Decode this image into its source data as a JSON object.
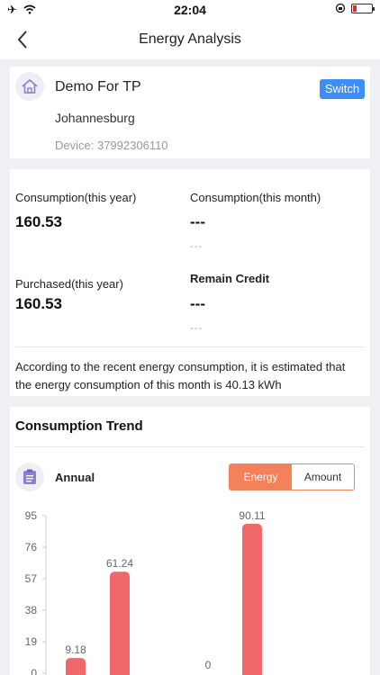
{
  "status_bar": {
    "time": "22:04"
  },
  "nav": {
    "title": "Energy Analysis"
  },
  "device": {
    "name": "Demo For TP",
    "city": "Johannesburg",
    "device_id": "Device: 37992306110",
    "switch_label": "Switch"
  },
  "stats": {
    "consumption_year_label": "Consumption(this year)",
    "consumption_year_value": "160.53",
    "consumption_month_label": "Consumption(this month)",
    "consumption_month_value": "---",
    "consumption_month_sub": "---",
    "purchased_year_label": "Purchased(this year)",
    "purchased_year_value": "160.53",
    "remain_credit_label": "Remain Credit",
    "remain_credit_value": "---",
    "remain_credit_sub": "---",
    "estimate_text": "According to the recent energy consumption, it is estimated that the energy consumption of this month is 40.13 kWh"
  },
  "trend": {
    "title": "Consumption Trend",
    "period_label": "Annual",
    "toggle_energy": "Energy",
    "toggle_amount": "Amount"
  },
  "colors": {
    "accent": "#f3825a",
    "bar": "#f0686a",
    "switch": "#3d8ef7"
  },
  "chart_data": {
    "type": "bar",
    "y_ticks": [
      0,
      19,
      38,
      57,
      76,
      95
    ],
    "ylim": [
      0,
      95
    ],
    "grid": false,
    "values": [
      9.18,
      61.24,
      0,
      90.11
    ],
    "labels": [
      "9.18",
      "61.24",
      "0",
      "90.11"
    ],
    "tick_labels": [
      "0",
      "19",
      "38",
      "57",
      "76",
      "95"
    ]
  }
}
